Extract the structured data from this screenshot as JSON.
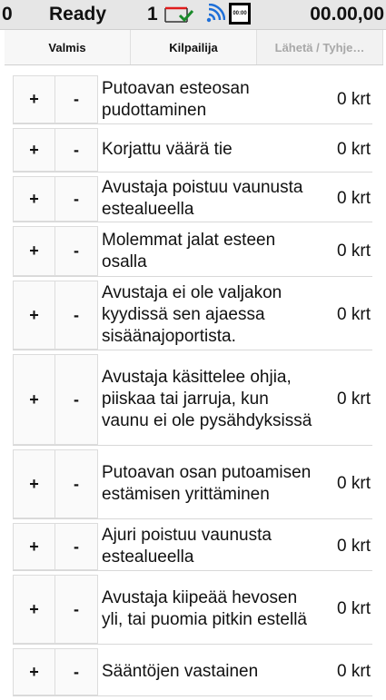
{
  "status": {
    "counter": "0",
    "state": "Ready",
    "number": "1",
    "clock_text": "00:00",
    "time": "00.00,00"
  },
  "tabs": [
    {
      "label": "Valmis",
      "enabled": true
    },
    {
      "label": "Kilpailija",
      "enabled": true
    },
    {
      "label": "Lähetä / Tyhje…",
      "enabled": false
    }
  ],
  "buttons": {
    "plus": "+",
    "minus": "-"
  },
  "rows": [
    {
      "label": "Putoavan esteosan pudottaminen",
      "count": "0 krt"
    },
    {
      "label": "Korjattu väärä tie",
      "count": "0 krt"
    },
    {
      "label": "Avustaja poistuu vaunusta estealueella",
      "count": "0 krt"
    },
    {
      "label": "Molemmat jalat esteen osalla",
      "count": "0 krt"
    },
    {
      "label": "Avustaja ei ole valjakon kyydissä sen ajaessa sisäänajoportista.",
      "count": "0 krt"
    },
    {
      "label": "Avustaja käsittelee ohjia, piiskaa tai jarruja, kun vaunu ei ole pysähdyksissä",
      "count": "0 krt"
    },
    {
      "label": "Putoavan osan putoamisen estämisen yrittäminen",
      "count": "0 krt"
    },
    {
      "label": "Ajuri poistuu vaunusta estealueella",
      "count": "0 krt"
    },
    {
      "label": "Avustaja kiipeää hevosen yli, tai puomia pitkin estellä",
      "count": "0 krt"
    },
    {
      "label": "Sääntöjen vastainen",
      "count": "0 krt"
    }
  ]
}
